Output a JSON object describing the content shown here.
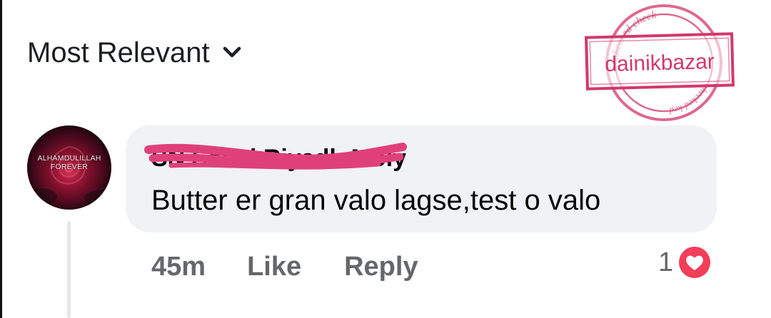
{
  "sort": {
    "label": "Most Relevant",
    "icon": "chevron-down-icon"
  },
  "watermark": {
    "brand": "dainikbazar",
    "ring_text_top": "checked check",
    "ring_text_bottom": "checked ked",
    "color": "#d2386c"
  },
  "comment": {
    "avatar_text": [
      "ALHAMDULILLAH",
      "FOREVER"
    ],
    "author": "SN Sahel Riyadh Moly",
    "text": "Butter er gran valo lagse,test o valo",
    "time": "45m",
    "like_label": "Like",
    "reply_label": "Reply",
    "reaction_count": "1",
    "reaction_icon": "heart-icon",
    "redaction_color": "#e0407a"
  }
}
